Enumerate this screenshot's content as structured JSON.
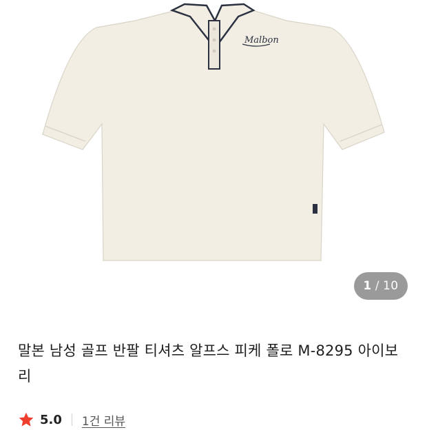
{
  "gallery": {
    "image_alt": "Malbon cream short-sleeve polo shirt",
    "logo_text": "Malbon",
    "counter_current": "1",
    "counter_separator": "/",
    "counter_total": "10"
  },
  "product": {
    "title": "말본 남성 골프 반팔 티셔츠 알프스 피케 폴로 M-8295 아이보리",
    "rating": "5.0",
    "reviews_label": "1건 리뷰"
  },
  "colors": {
    "shirt": "#f2eee4",
    "trim": "#2b3140",
    "star": "#f03e2e",
    "counter_bg": "#9a9a9a"
  },
  "icons": [
    "star-icon"
  ]
}
